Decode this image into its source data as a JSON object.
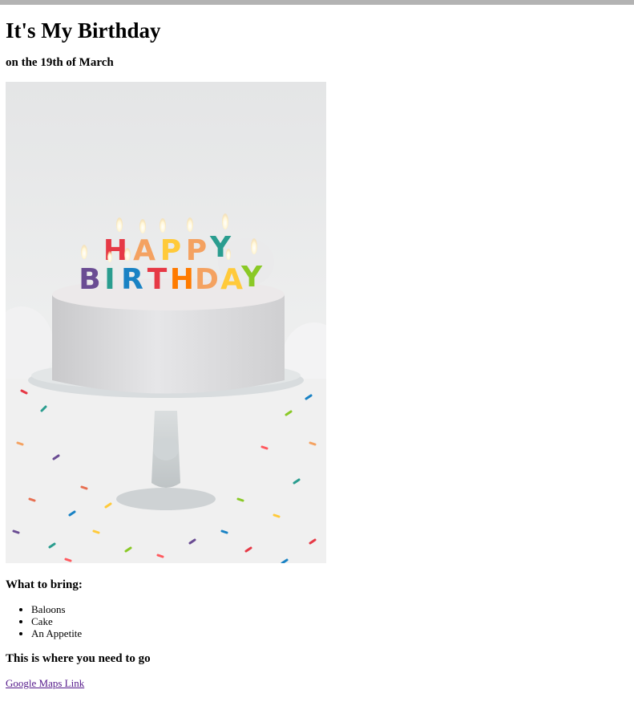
{
  "page": {
    "title": "It's My Birthday",
    "subtitle": "on the 19th of March"
  },
  "image": {
    "subject": "birthday-cake-photo",
    "candle_letters_row1": "HAPPY",
    "candle_letters_row2": "BIRTHDAY"
  },
  "bring": {
    "heading": "What to bring:",
    "items": [
      "Baloons",
      "Cake",
      "An Appetite"
    ]
  },
  "location": {
    "heading": "This is where you need to go",
    "link_text": "Google Maps Link"
  },
  "colors": {
    "top_bar": "#b3b3b3",
    "visited_link": "#551a8b"
  }
}
